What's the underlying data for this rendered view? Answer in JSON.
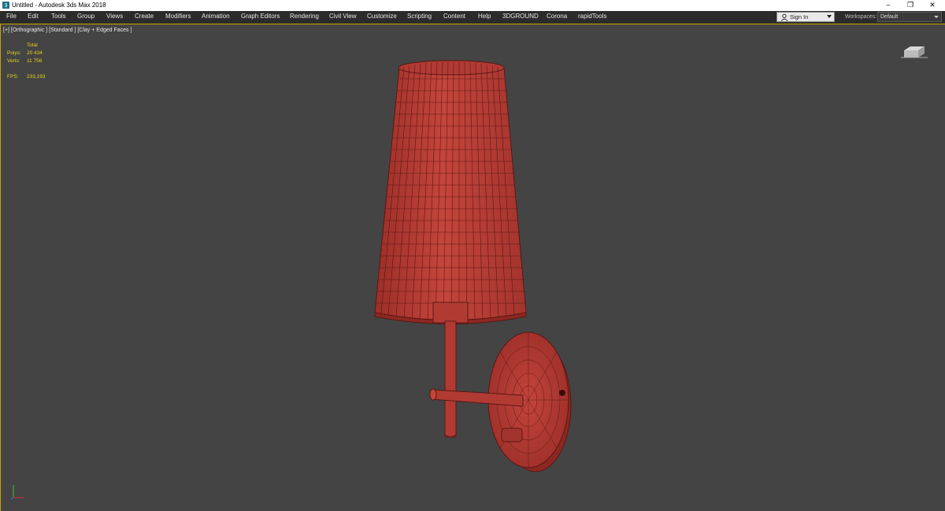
{
  "window": {
    "title": "Untitled - Autodesk 3ds Max 2018"
  },
  "window_controls": [
    "–",
    "❐",
    "✕"
  ],
  "menu": [
    "File",
    "Edit",
    "Tools",
    "Group",
    "Views",
    "Create",
    "Modifiers",
    "Animation",
    "Graph Editors",
    "Rendering",
    "Civil View",
    "Customize",
    "Scripting",
    "Content",
    "Help",
    "3DGROUND",
    "Corona",
    "rapidTools"
  ],
  "signin": {
    "label": "Sign In",
    "icon": "user-icon"
  },
  "workspaces": {
    "label": "Workspaces:",
    "value": "Default"
  },
  "viewport": {
    "label": "[+] [Orthographic ] [Standard ] [Clay + Edged Faces ]",
    "stats": {
      "header": "Total",
      "polys_label": "Polys:",
      "polys": "20 434",
      "verts_label": "Verts:",
      "verts": "11 756",
      "fps_label": "FPS:",
      "fps": "233,193"
    }
  },
  "colors": {
    "viewport_bg": "#444444",
    "stat_text": "#e6d31a",
    "model_clay": "#b53a32",
    "active_border": "#c9a400"
  }
}
